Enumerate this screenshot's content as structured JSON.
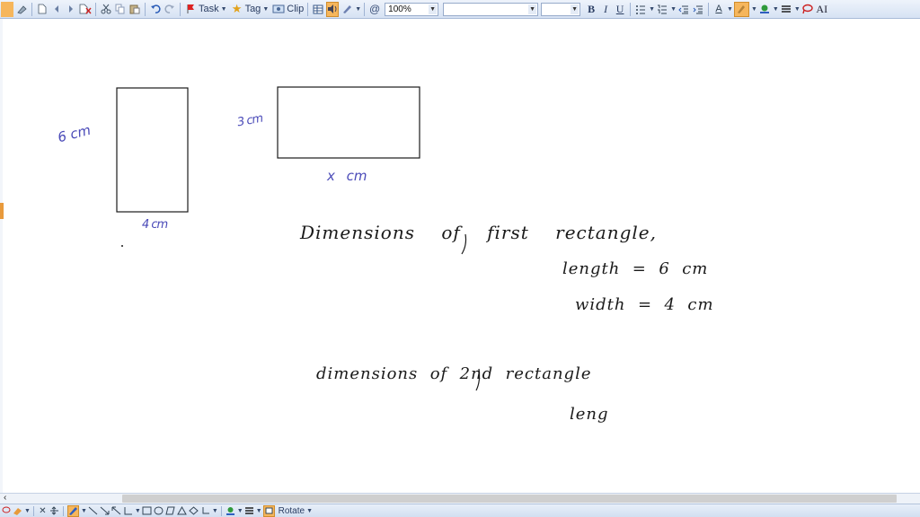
{
  "toolbar": {
    "task_label": "Task",
    "tag_label": "Tag",
    "clip_label": "Clip",
    "zoom_value": "100%",
    "font_name": "",
    "font_size": "",
    "bold": "B",
    "italic": "I",
    "underline": "U",
    "font_color_letter": "A",
    "text_size_label": "AI",
    "highlight_color": "#f6b65c",
    "pen_color": "#2f5fbf"
  },
  "drawing": {
    "rect1_height_label": "6 cm",
    "rect1_width_label": "4 cm",
    "rect2_height_label": "3 cm",
    "rect2_width_label": "x cm",
    "line1": "Dimensions of first rectangle,",
    "line2": "length  =  6  cm",
    "line3": "width  =  4  cm",
    "line4": "dimensions  of  2nd  rectangle",
    "line5": "leng",
    "ink_color": "#1a1a1a",
    "label_color": "#4a4ab8"
  },
  "bottom_toolbar": {
    "rotate_label": "Rotate"
  }
}
